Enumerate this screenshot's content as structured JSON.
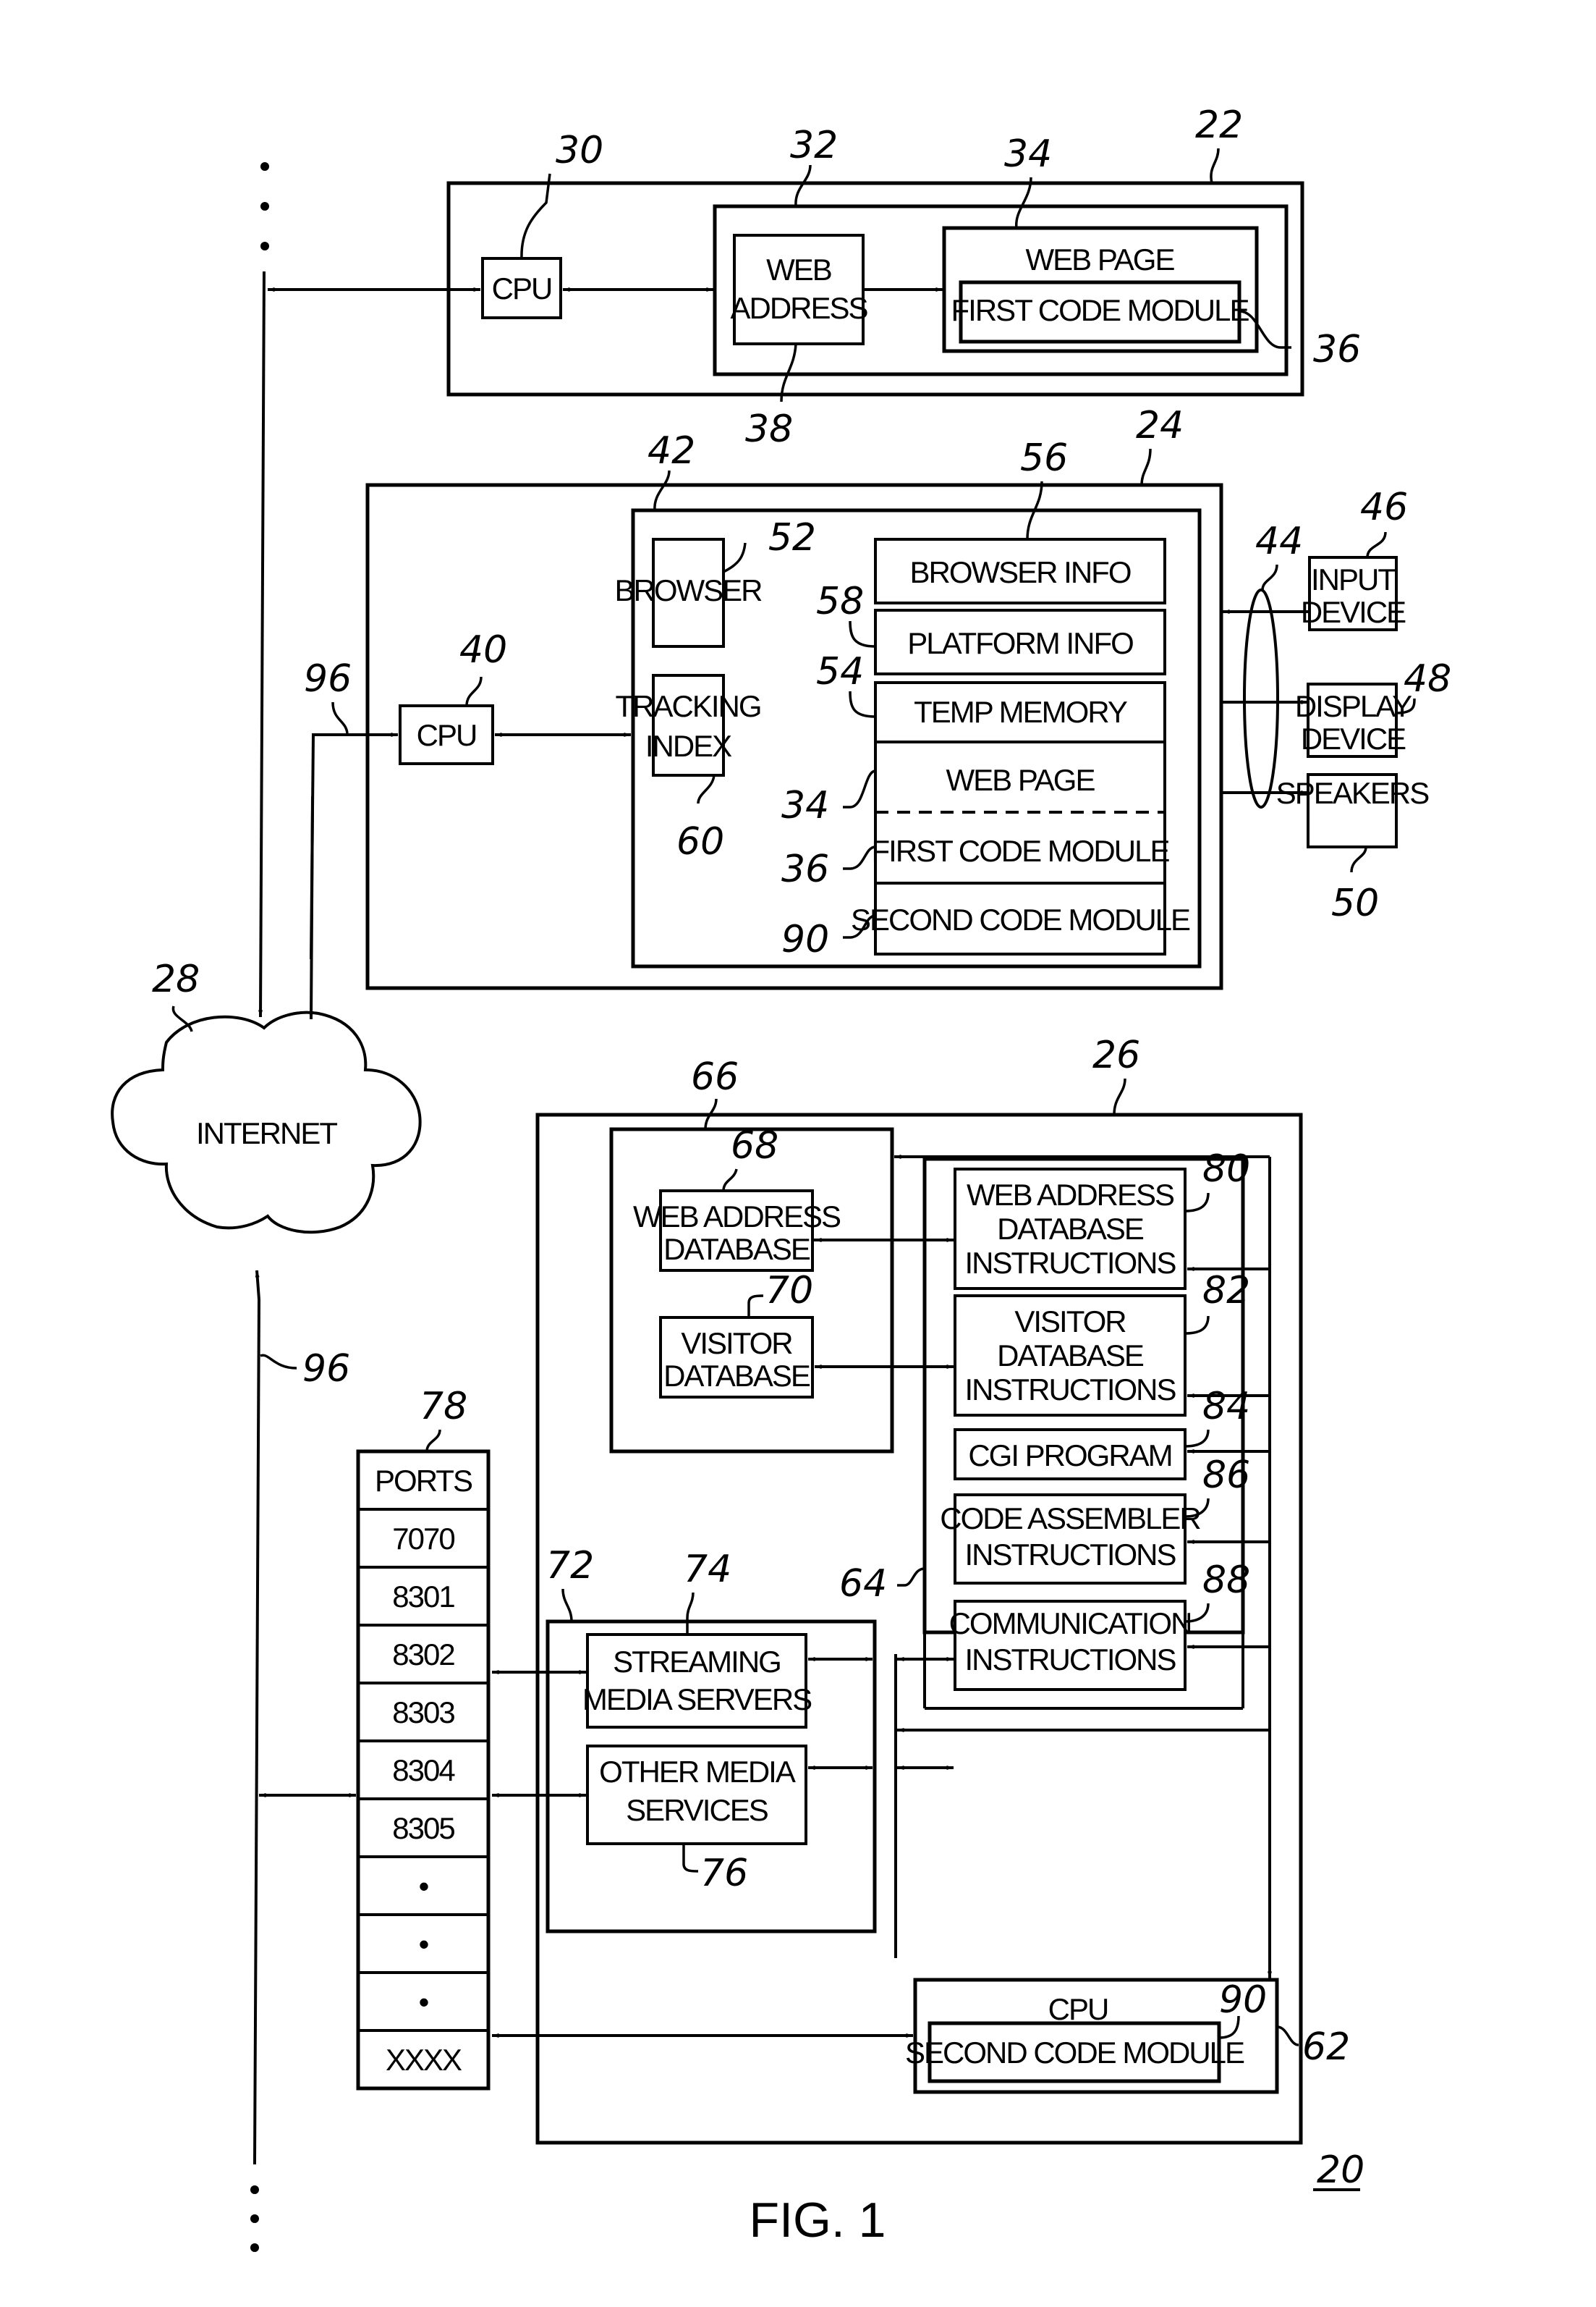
{
  "figure": {
    "caption": "FIG. 1",
    "system_ref": "20"
  },
  "network": {
    "internet_label": "INTERNET",
    "internet_ref": "28",
    "link_ref": "96",
    "link_ref_bottom": "96"
  },
  "server_22": {
    "ref": "22",
    "cpu": {
      "label": "CPU",
      "ref": "30"
    },
    "memory_ref": "32",
    "web_address": {
      "lines": [
        "WEB",
        "ADDRESS"
      ],
      "ref": "38"
    },
    "web_page": {
      "label": "WEB PAGE",
      "ref": "34"
    },
    "first_code_module": {
      "label": "FIRST CODE MODULE",
      "ref": "36"
    }
  },
  "client_24": {
    "ref": "24",
    "cpu": {
      "label": "CPU",
      "ref": "40"
    },
    "memory_ref": "42",
    "browser": {
      "label": "BROWSER",
      "ref": "52"
    },
    "tracking_index": {
      "lines": [
        "TRACKING",
        "INDEX"
      ],
      "ref": "60"
    },
    "browser_info": {
      "label": "BROWSER INFO",
      "ref": "56"
    },
    "platform_info": {
      "label": "PLATFORM INFO",
      "ref": "58"
    },
    "temp_memory": {
      "label": "TEMP MEMORY",
      "ref": "54"
    },
    "web_page": {
      "label": "WEB PAGE",
      "ref": "34"
    },
    "first_code_module": {
      "label": "FIRST CODE MODULE",
      "ref": "36"
    },
    "second_code_module": {
      "label": "SECOND CODE MODULE",
      "ref": "90"
    },
    "io_bus_ref": "44",
    "input_device": {
      "lines": [
        "INPUT",
        "DEVICE"
      ],
      "ref": "46"
    },
    "display_device": {
      "lines": [
        "DISPLAY",
        "DEVICE"
      ],
      "ref": "48"
    },
    "speakers": {
      "label": "SPEAKERS",
      "ref": "50"
    }
  },
  "server_26": {
    "ref": "26",
    "database_group_ref": "66",
    "web_address_database": {
      "lines": [
        "WEB ADDRESS",
        "DATABASE"
      ],
      "ref": "68"
    },
    "visitor_database": {
      "lines": [
        "VISITOR",
        "DATABASE"
      ],
      "ref": "70"
    },
    "instructions_group_ref": "64",
    "web_address_db_instructions": {
      "lines": [
        "WEB ADDRESS",
        "DATABASE",
        "INSTRUCTIONS"
      ],
      "ref": "80"
    },
    "visitor_db_instructions": {
      "lines": [
        "VISITOR",
        "DATABASE",
        "INSTRUCTIONS"
      ],
      "ref": "82"
    },
    "cgi_program": {
      "label": "CGI PROGRAM",
      "ref": "84"
    },
    "code_assembler": {
      "lines": [
        "CODE ASSEMBLER",
        "INSTRUCTIONS"
      ],
      "ref": "86"
    },
    "communication": {
      "lines": [
        "COMMUNICATION",
        "INSTRUCTIONS"
      ],
      "ref": "88"
    },
    "media_group_ref": "72",
    "streaming_media_servers": {
      "lines": [
        "STREAMING",
        "MEDIA SERVERS"
      ],
      "ref": "74"
    },
    "other_media_services": {
      "lines": [
        "OTHER MEDIA",
        "SERVICES"
      ],
      "ref": "76"
    },
    "cpu": {
      "label": "CPU",
      "ref": "62"
    },
    "second_code_module": {
      "label": "SECOND CODE MODULE",
      "ref": "90"
    }
  },
  "ports": {
    "ref": "78",
    "header": "PORTS",
    "rows": [
      "7070",
      "8301",
      "8302",
      "8303",
      "8304",
      "8305",
      "•",
      "•",
      "•",
      "XXXX"
    ]
  }
}
